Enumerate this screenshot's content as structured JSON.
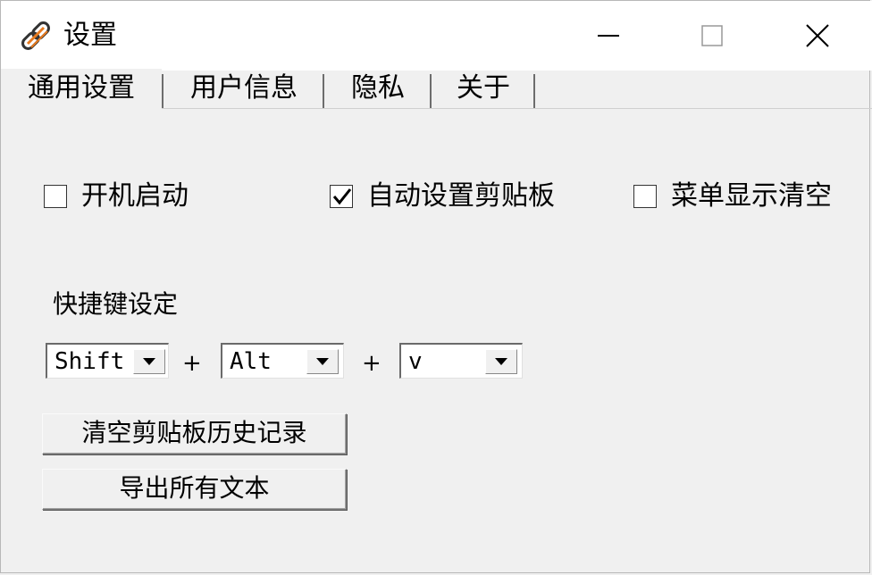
{
  "window": {
    "title": "设置",
    "icon": "chain-link-icon"
  },
  "tabs": [
    {
      "label": "通用设置",
      "active": true
    },
    {
      "label": "用户信息",
      "active": false
    },
    {
      "label": "隐私",
      "active": false
    },
    {
      "label": "关于",
      "active": false
    }
  ],
  "options": {
    "startup": {
      "label": "开机启动",
      "checked": false
    },
    "auto_clipboard": {
      "label": "自动设置剪贴板",
      "checked": true
    },
    "menu_clear": {
      "label": "菜单显示清空",
      "checked": false
    }
  },
  "hotkey": {
    "label": "快捷键设定",
    "key1": "Shift",
    "key2": "Alt",
    "key3": "v",
    "separator": "+"
  },
  "buttons": {
    "clear_history": "清空剪贴板历史记录",
    "export_text": "导出所有文本"
  }
}
